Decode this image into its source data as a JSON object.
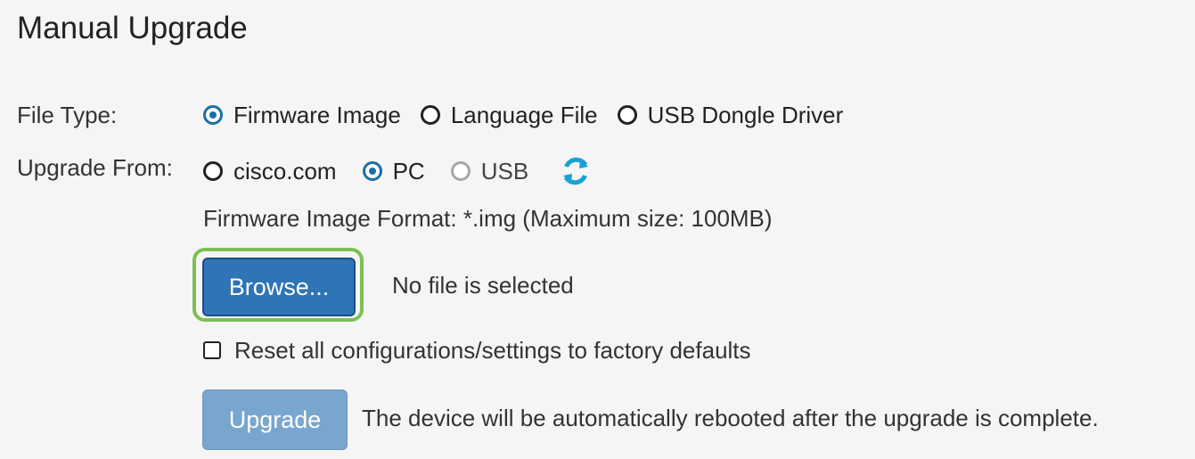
{
  "page": {
    "title": "Manual Upgrade"
  },
  "file_type": {
    "label": "File Type:",
    "options": [
      {
        "label": "Firmware Image",
        "selected": true
      },
      {
        "label": "Language File",
        "selected": false
      },
      {
        "label": "USB Dongle Driver",
        "selected": false
      }
    ]
  },
  "upgrade_from": {
    "label": "Upgrade From:",
    "options": [
      {
        "label": "cisco.com",
        "selected": false,
        "disabled": false
      },
      {
        "label": "PC",
        "selected": true,
        "disabled": false
      },
      {
        "label": "USB",
        "selected": false,
        "disabled": true
      }
    ],
    "refresh_icon": "refresh-icon"
  },
  "format": {
    "text": "Firmware Image Format: *.img (Maximum size: 100MB)"
  },
  "browse": {
    "button_label": "Browse...",
    "file_status": "No file is selected"
  },
  "reset": {
    "label": "Reset all configurations/settings to factory defaults",
    "checked": false
  },
  "upgrade": {
    "button_label": "Upgrade",
    "note": "The device will be automatically rebooted after the upgrade is complete."
  },
  "colors": {
    "accent": "#1d6fa5",
    "browse_button": "#2f74b5",
    "browse_highlight": "#7cc054",
    "upgrade_button_disabled": "#78a6ce",
    "refresh_icon": "#1aa0d8"
  }
}
